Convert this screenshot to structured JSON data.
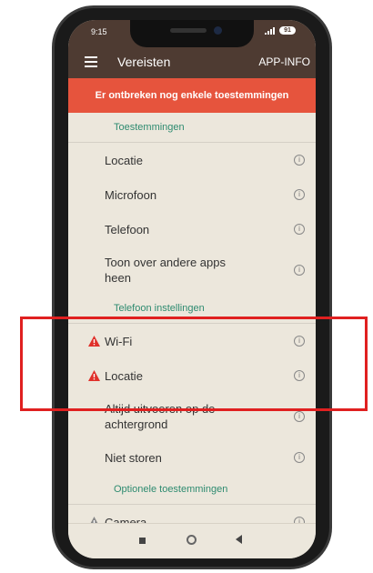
{
  "status_bar": {
    "time": "9:15",
    "battery": "91"
  },
  "app_bar": {
    "title": "Vereisten",
    "action": "APP-INFO"
  },
  "banner": "Er ontbreken nog enkele toestemmingen",
  "sections": {
    "toestemmingen": {
      "header": "Toestemmingen",
      "items": [
        "Locatie",
        "Microfoon",
        "Telefoon",
        "Toon over andere apps heen"
      ]
    },
    "telefoon_instellingen": {
      "header": "Telefoon instellingen",
      "items": [
        "Wi-Fi",
        "Locatie",
        "Altijd uitvoeren op de achtergrond",
        "Niet storen"
      ]
    },
    "optionele": {
      "header": "Optionele toestemmingen",
      "items": [
        "Camera"
      ]
    }
  },
  "info_glyph": "i",
  "colors": {
    "app_bar": "#4e3b32",
    "banner": "#e6543d",
    "section_header": "#2e8b70",
    "warning": "#e0302a",
    "highlight": "#e02020"
  }
}
